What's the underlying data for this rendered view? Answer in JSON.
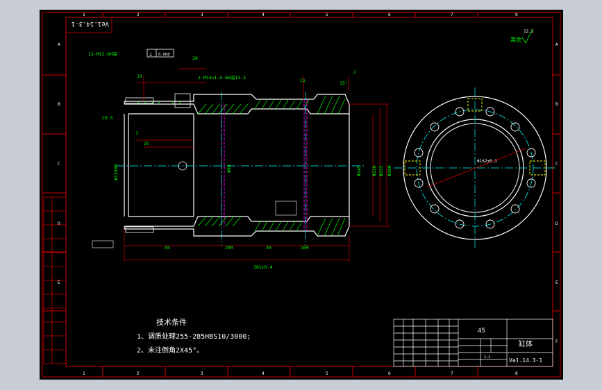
{
  "title_block_tl": "Ve1.14.3-1",
  "roughness_note": "其余",
  "roughness_value": "12.5",
  "material": "45",
  "part_name": "缸体",
  "drawing_no": "Ve1.14.3-1",
  "scale_label": "1:1",
  "tech_title": "技术条件",
  "tech_line1": "1、调质处理255-285HBS10/3000;",
  "tech_line2": "2、未注倒角2X45°。",
  "grid_cols": [
    "1",
    "2",
    "3",
    "4",
    "5",
    "6",
    "7",
    "8"
  ],
  "grid_rows": [
    "A",
    "B",
    "C",
    "D",
    "E",
    "F"
  ],
  "dims": {
    "d_overall": "381±0.4",
    "d_55": "55",
    "d_30": "30",
    "d_100": "100",
    "d_200": "200",
    "d_28": "28",
    "d_23": "23",
    "d_1_5": "1.5",
    "d_25": "25",
    "d_3": "3",
    "d_2": "2",
    "d_15": "15°",
    "dia_135": "Φ135H8",
    "dia_150": "Φ150",
    "dia_155": "Φ155",
    "dia_180": "Φ180",
    "dia_145": "Φ145",
    "dia_60": "Φ60",
    "dia_pcd": "Φ162±0.1",
    "thread": "12-M12-6H深",
    "thread2": "2-M14×1.5-6H深13.5",
    "tol": "0.008",
    "c05": "C0.5",
    "c1": "C1"
  }
}
